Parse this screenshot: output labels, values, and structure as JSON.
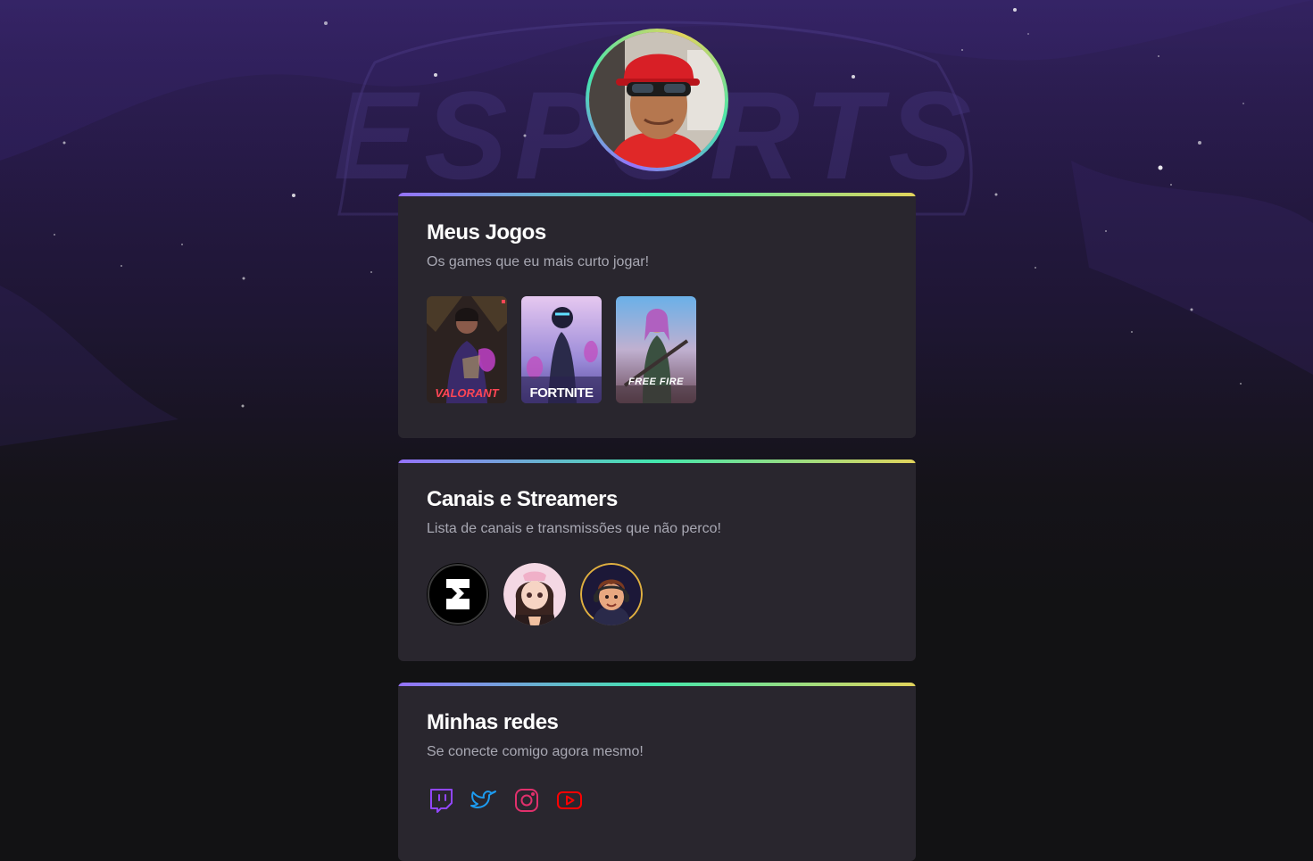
{
  "profile": {
    "avatar_alt": "avatar"
  },
  "games_card": {
    "title": "Meus Jogos",
    "subtitle": "Os games que eu mais curto jogar!",
    "games": [
      {
        "name": "valorant",
        "label": "VALORANT",
        "color": "#ff4655"
      },
      {
        "name": "fortnite",
        "label": "FORTNITE",
        "color": "#ffffff"
      },
      {
        "name": "free-fire",
        "label": "FREE FIRE",
        "color": "#ffffff"
      }
    ]
  },
  "streamers_card": {
    "title": "Canais e Streamers",
    "subtitle": "Lista de canais e transmissões que não perco!"
  },
  "socials_card": {
    "title": "Minhas redes",
    "subtitle": "Se conecte comigo agora mesmo!",
    "icons": [
      {
        "name": "twitch-icon",
        "color": "#9146ff"
      },
      {
        "name": "twitter-icon",
        "color": "#1d9bf0"
      },
      {
        "name": "instagram-icon",
        "color": "#e1306c"
      },
      {
        "name": "youtube-icon",
        "color": "#ff0000"
      }
    ]
  },
  "background": {
    "watermark_text": "ESPORTS"
  }
}
